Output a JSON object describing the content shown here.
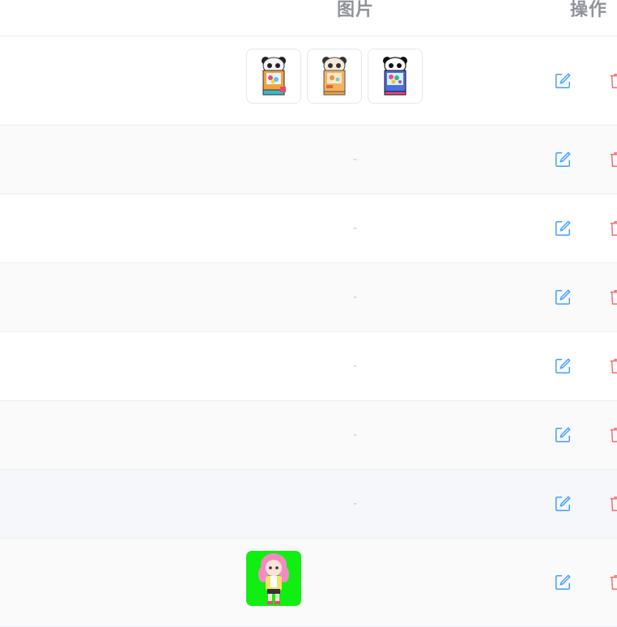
{
  "table": {
    "headers": {
      "image": "图片",
      "action": "操作"
    },
    "empty_placeholder": "-",
    "rows": [
      {
        "type": "images",
        "images": [
          "panda-claw-machine-image",
          "panda-claw-machine-image",
          "panda-claw-machine-image"
        ]
      },
      {
        "type": "empty"
      },
      {
        "type": "empty"
      },
      {
        "type": "empty"
      },
      {
        "type": "empty"
      },
      {
        "type": "empty"
      },
      {
        "type": "empty"
      },
      {
        "type": "images",
        "images": [
          "pink-hair-girl-figure-image"
        ]
      }
    ],
    "colors": {
      "edit": "#409eff",
      "delete": "#f56c6c",
      "header_text": "#909399",
      "placeholder": "#c0c4cc"
    }
  }
}
